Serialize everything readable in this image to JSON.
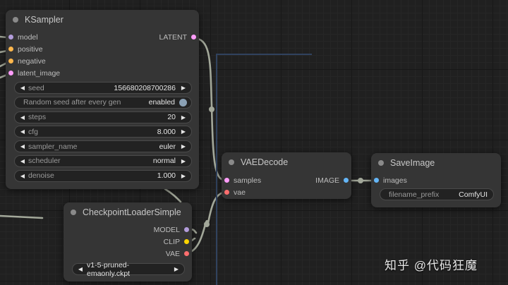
{
  "ksampler": {
    "title": "KSampler",
    "inputs": [
      {
        "label": "model",
        "color": "#b39ddb"
      },
      {
        "label": "positive",
        "color": "#ffb74d"
      },
      {
        "label": "negative",
        "color": "#ffb74d"
      },
      {
        "label": "latent_image",
        "color": "#ff9cf9"
      }
    ],
    "output": {
      "label": "LATENT",
      "color": "#ff9cf9"
    },
    "widgets": {
      "seed": {
        "label": "seed",
        "value": "156680208700286"
      },
      "control_after_generate": {
        "label": "Random seed after every gen",
        "value": "enabled"
      },
      "steps": {
        "label": "steps",
        "value": "20"
      },
      "cfg": {
        "label": "cfg",
        "value": "8.000"
      },
      "sampler_name": {
        "label": "sampler_name",
        "value": "euler"
      },
      "scheduler": {
        "label": "scheduler",
        "value": "normal"
      },
      "denoise": {
        "label": "denoise",
        "value": "1.000"
      }
    }
  },
  "vaedecode": {
    "title": "VAEDecode",
    "inputs": [
      {
        "label": "samples",
        "color": "#ff9cf9"
      },
      {
        "label": "vae",
        "color": "#ff6e6e"
      }
    ],
    "output": {
      "label": "IMAGE",
      "color": "#64b5f6"
    }
  },
  "saveimage": {
    "title": "SaveImage",
    "inputs": [
      {
        "label": "images",
        "color": "#64b5f6"
      }
    ],
    "widgets": {
      "filename_prefix": {
        "label": "filename_prefix",
        "value": "ComfyUI"
      }
    }
  },
  "checkpoint": {
    "title": "CheckpointLoaderSimple",
    "outputs": [
      {
        "label": "MODEL",
        "color": "#b39ddb"
      },
      {
        "label": "CLIP",
        "color": "#ffd500"
      },
      {
        "label": "VAE",
        "color": "#ff6e6e"
      }
    ],
    "widgets": {
      "ckpt_name": {
        "value": "v1-5-pruned-emaonly.ckpt"
      }
    }
  },
  "link_color": "#a3a89a",
  "watermark": "知乎 @代码狂魔"
}
